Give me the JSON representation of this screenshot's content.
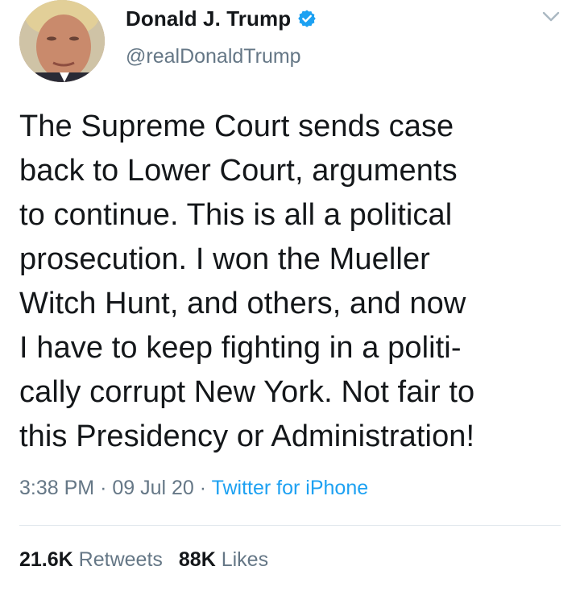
{
  "author": {
    "display_name": "Donald J. Trump",
    "handle": "@realDonaldTrump",
    "verified": true,
    "avatar_icon": "profile-photo"
  },
  "tweet": {
    "text": "The Supreme Court sends case\nback to Lower Court, arguments\nto continue. This is all a political\nprosecution. I won the Mueller\nWitch Hunt, and others, and now\nI have to keep fighting in a politi-\ncally corrupt New York. Not fair to\nthis Presidency or Administration!",
    "time": "3:38 PM",
    "separator": "·",
    "date": "09 Jul 20",
    "source": "Twitter for iPhone"
  },
  "stats": {
    "retweets_count": "21.6K",
    "retweets_label": "Retweets",
    "likes_count": "88K",
    "likes_label": "Likes"
  },
  "colors": {
    "text": "#14171a",
    "secondary": "#657786",
    "link": "#1da1f2",
    "verified": "#1da1f2",
    "divider": "#e1e8ed"
  },
  "icons": {
    "verified": "verified-badge-icon",
    "menu": "chevron-down-icon"
  }
}
